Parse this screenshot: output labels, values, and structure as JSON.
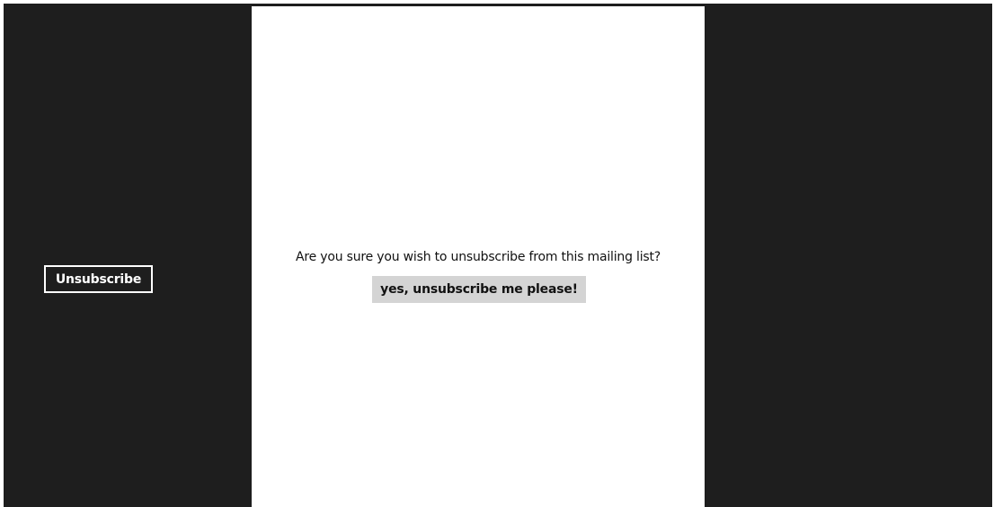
{
  "sidebar": {
    "button_label": "Unsubscribe"
  },
  "dialog": {
    "question": "Are you sure you wish to unsubscribe from this mailing list?",
    "confirm_label": "yes, unsubscribe me please!"
  },
  "colors": {
    "dark_background": "#1e1e1e",
    "content_background": "#ffffff",
    "confirm_button_background": "#d4d4d4",
    "text": "#111111"
  }
}
